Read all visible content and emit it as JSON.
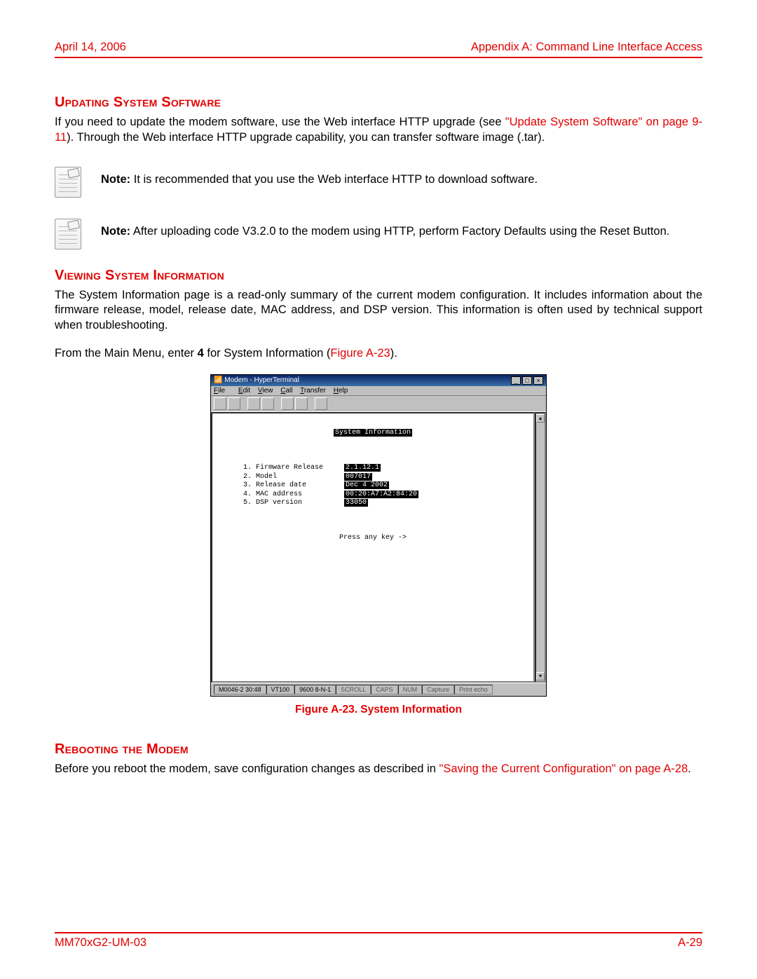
{
  "header": {
    "date": "April 14, 2006",
    "appendix": "Appendix A: Command Line Interface Access"
  },
  "sec1": {
    "title": "Updating System Software",
    "p1a": "If you need to update the modem software, use the Web interface HTTP upgrade (see ",
    "p1link": "\"Update System Software\" on page 9-11",
    "p1b": "). Through the Web interface HTTP upgrade capability, you can transfer software image (.tar).",
    "note1_label": "Note:",
    "note1": " It is recommended that you use the Web interface HTTP to download software.",
    "note2_label": "Note:",
    "note2": " After uploading code V3.2.0 to the modem using HTTP, perform Factory Defaults using the Reset Button."
  },
  "sec2": {
    "title": "Viewing System Information",
    "p1": "The System Information page is a read-only summary of the current modem configuration. It includes information about the firmware release, model, release date, MAC address, and DSP version. This information is often used by technical support when troubleshooting.",
    "p2a": "From the Main Menu, enter ",
    "p2b": "4",
    "p2c": " for System Information (",
    "p2link": "Figure A-23",
    "p2d": ")."
  },
  "figure": {
    "window_title": "Modem - HyperTerminal",
    "menu": {
      "file": "File",
      "edit": "Edit",
      "view": "View",
      "call": "Call",
      "transfer": "Transfer",
      "help": "Help"
    },
    "term_title": "System Information",
    "rows": [
      {
        "n": "1.",
        "label": "Firmware Release",
        "val": "2.1.12.1"
      },
      {
        "n": "2.",
        "label": "Model",
        "val": "007017"
      },
      {
        "n": "3.",
        "label": "Release date",
        "val": "Dec 4 2002"
      },
      {
        "n": "4.",
        "label": "MAC address",
        "val": "00:20:A7:A2:84:20"
      },
      {
        "n": "5.",
        "label": "DSP version",
        "val": "33050"
      }
    ],
    "prompt": "Press any key ->",
    "status": {
      "conn": "M0046-2 30:48",
      "term": "VT100",
      "baud": "9600 8-N-1",
      "scroll": "SCROLL",
      "caps": "CAPS",
      "num": "NUM",
      "capture": "Capture",
      "print": "Print echo"
    },
    "caption": "Figure A-23. System Information"
  },
  "sec3": {
    "title": "Rebooting the Modem",
    "p1a": "Before you reboot the modem, save configuration changes as described in ",
    "p1link": "\"Saving the Current Configuration\" on page A-28",
    "p1b": "."
  },
  "footer": {
    "left": "MM70xG2-UM-03",
    "right": "A-29"
  }
}
